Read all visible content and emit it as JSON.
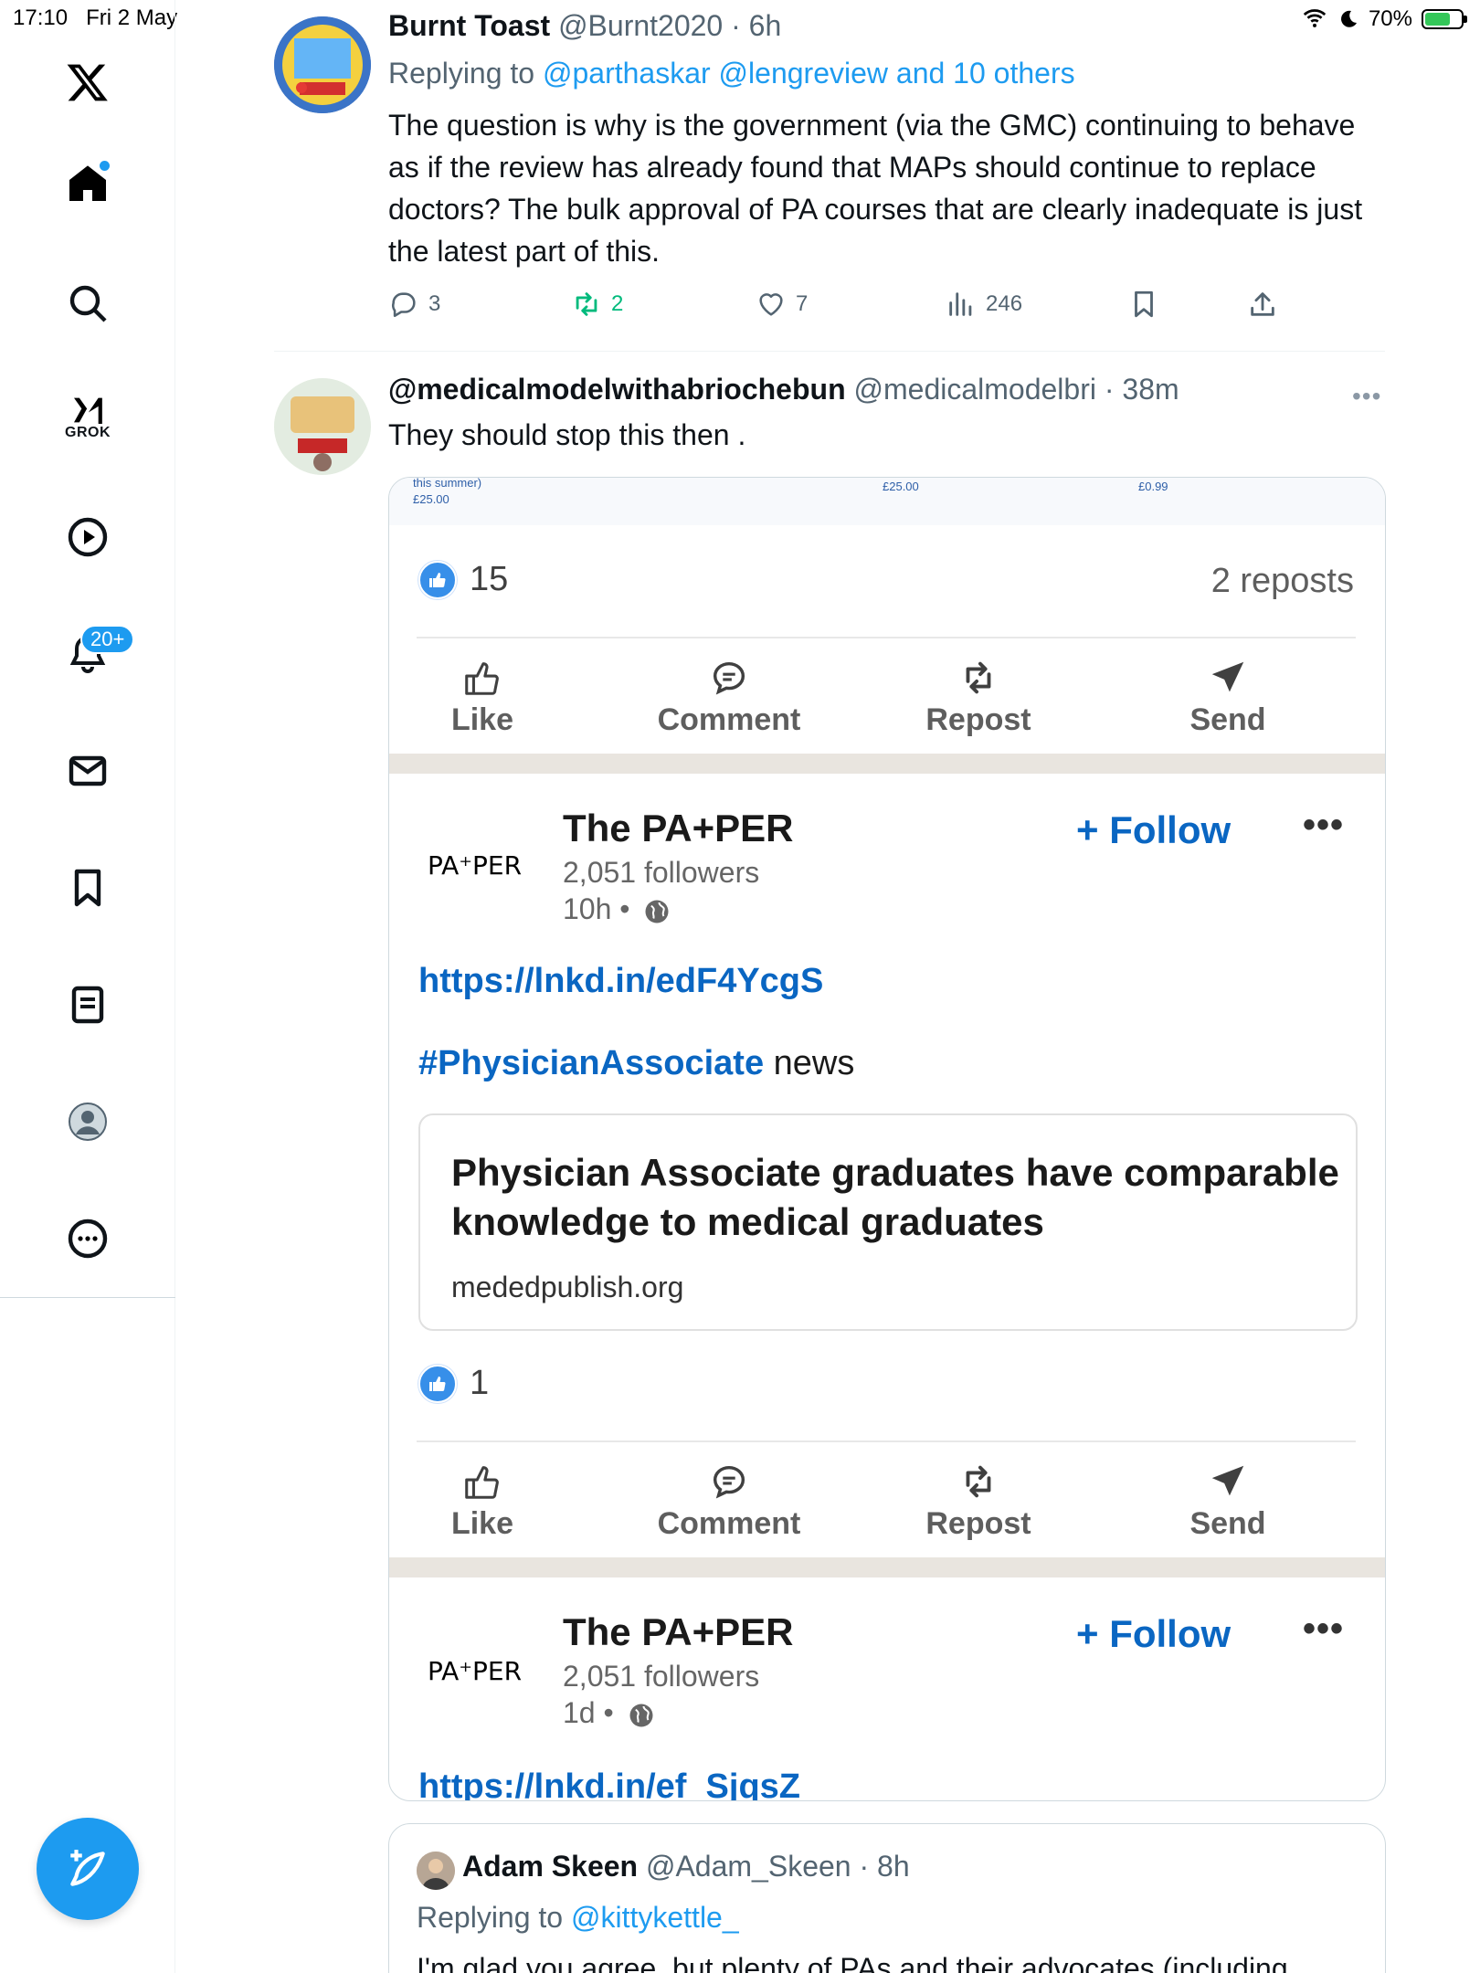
{
  "status_bar": {
    "time": "17:10",
    "date": "Fri 2 May",
    "battery": "70%",
    "battery_level": 0.7
  },
  "sidebar": {
    "items": [
      {
        "icon": "x-logo-icon"
      },
      {
        "icon": "home-icon"
      },
      {
        "icon": "search-icon"
      },
      {
        "icon": "grok-icon",
        "label": "GROK"
      },
      {
        "icon": "video-icon"
      },
      {
        "icon": "bell-icon",
        "badge": "20+"
      },
      {
        "icon": "mail-icon"
      },
      {
        "icon": "bookmark-icon"
      },
      {
        "icon": "lists-icon"
      },
      {
        "icon": "profile-icon"
      },
      {
        "icon": "more-icon"
      }
    ],
    "compose_icon": "compose-icon"
  },
  "tweet1": {
    "name": "Burnt Toast",
    "handle": "@Burnt2020",
    "time": "6h",
    "replying_prefix": "Replying to",
    "replying_to": "@parthaskar @lengreview and 10 others",
    "text": "The question is why is the government (via the GMC) continuing to behave as if the review has already found that MAPs should continue to replace doctors? The bulk approval of PA courses that are clearly inadequate is just the latest part of this.",
    "replies": "3",
    "reposts": "2",
    "likes": "7",
    "views": "246",
    "accent": "#1d9bf0",
    "repost_color": "#00ba7c"
  },
  "tweet2": {
    "name": "@medicalmodelwithabriochebun",
    "handle": "@medicalmodelbri",
    "time": "38m",
    "text": "They should stop this then .",
    "media": {
      "strip": {
        "left_top": "this summer)",
        "left_price": "£25.00",
        "mid_price": "£25.00",
        "right_price": "£0.99"
      },
      "post1": {
        "reactions": "15",
        "reposts": "2 reposts"
      },
      "actions": {
        "like": "Like",
        "comment": "Comment",
        "repost": "Repost",
        "send": "Send"
      },
      "post2": {
        "logo": "PA⁺PER",
        "page_name": "The PA+PER",
        "followers": "2,051 followers",
        "age": "10h •",
        "follow": "+ Follow",
        "link": "https://lnkd.in/edF4YcgS",
        "hashtag": "#PhysicianAssociate",
        "hashtag_suffix": "news",
        "article_title": "Physician Associate graduates have comparable knowledge to medical graduates",
        "article_domain": "mededpublish.org",
        "reactions": "1"
      },
      "post3": {
        "logo": "PA⁺PER",
        "page_name": "The PA+PER",
        "followers": "2,051 followers",
        "age": "1d •",
        "follow": "+ Follow",
        "link": "https://lnkd.in/ef_SjqsZ"
      },
      "linkedin_blue": "#0a66c2"
    }
  },
  "quote": {
    "name": "Adam Skeen",
    "handle": "@Adam_Skeen",
    "time": "8h",
    "replying_prefix": "Replying to",
    "replying_to": "@kittykettle_",
    "text_cut": "I'm glad you agree, but plenty of PAs and their advocates (including"
  }
}
